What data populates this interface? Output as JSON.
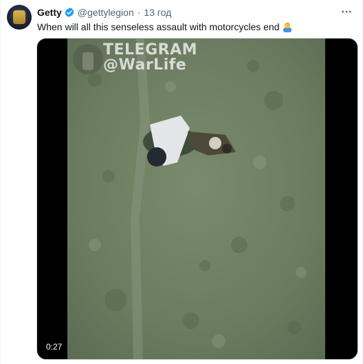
{
  "tweet": {
    "author_name": "Getty",
    "handle": "@gettylegion",
    "separator": "·",
    "time": "13 год",
    "text": "When will all this senseless assault with motorcycles end",
    "emoji": "person-facepalming-emoji",
    "more_icon": "more-horizontal-icon"
  },
  "media": {
    "watermark_line1": "TELEGRAM",
    "watermark_line2": "@WarLife",
    "duration": "0:27"
  },
  "colors": {
    "verified_badge": "#1d9bf0",
    "text_primary": "#0f1419",
    "text_secondary": "#536471",
    "video_grass": "#6f7f63"
  }
}
